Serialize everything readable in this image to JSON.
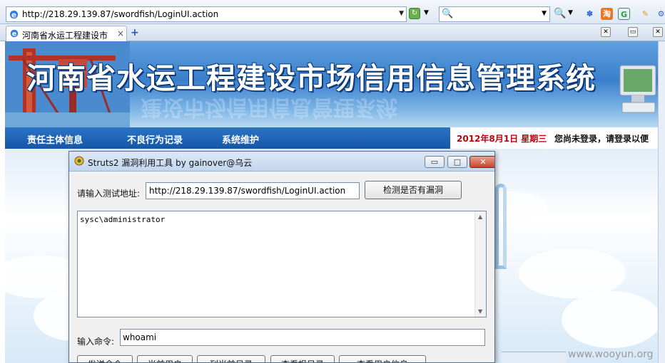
{
  "browser": {
    "address": "http://218.29.139.87/swordfish/LoginUI.action",
    "search_value": "",
    "tab_label": "河南省水运工程建设市",
    "tab_close": "×",
    "new_tab": "+"
  },
  "site": {
    "banner_title": "河南省水运工程建设市场信用信息管理系统",
    "banner_reflection": "建设市场信用信息管理系统",
    "nav": [
      "责任主体信息",
      "不良行为记录",
      "系统维护"
    ],
    "date": "2012年8月1日  星期三",
    "login_notice": "您尚未登录，请登录以便"
  },
  "dialog": {
    "title": "Struts2 漏洞利用工具 by gainover@乌云",
    "url_label": "请输入测试地址:",
    "url_value": "http://218.29.139.87/swordfish/LoginUI.action",
    "check_button": "检测是否有漏洞",
    "output": "sysc\\administrator",
    "cmd_label": "输入命令:",
    "cmd_value": "whoami",
    "buttons": [
      "发送命令",
      "当前用户",
      "列当前目录",
      "查看根目录",
      "查看用户信息"
    ],
    "window_buttons": {
      "minimize": "▭",
      "maximize": "□",
      "close": "✕"
    }
  },
  "watermark": "www.wooyun.org",
  "colors": {
    "nav_bar": "#1c62b3",
    "date_red": "#c0000b",
    "banner_title": "#ffffff"
  }
}
